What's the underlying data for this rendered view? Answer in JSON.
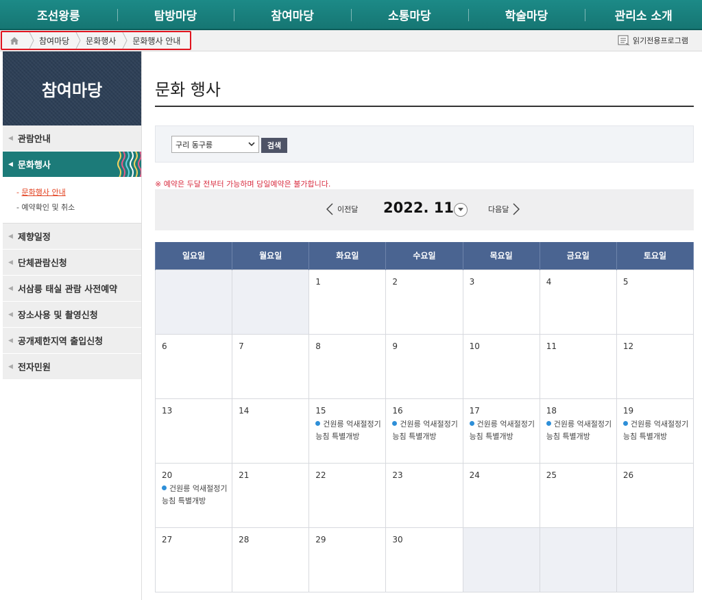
{
  "topnav": {
    "items": [
      "조선왕릉",
      "탐방마당",
      "참여마당",
      "소통마당",
      "학술마당",
      "관리소 소개"
    ]
  },
  "breadcrumb": {
    "items": [
      "참여마당",
      "문화행사",
      "문화행사 안내"
    ]
  },
  "reader_label": "읽기전용프로그램",
  "sidebar": {
    "title": "참여마당",
    "items": [
      "관람안내",
      "문화행사",
      "제향일정",
      "단체관람신청",
      "서삼릉 태실 관람 사전예약",
      "장소사용 및 촬영신청",
      "공개제한지역 출입신청",
      "전자민원"
    ],
    "sub_items": [
      "문화행사 안내",
      "예약확인 및 취소"
    ]
  },
  "main": {
    "title": "문화 행사",
    "select_value": "구리 동구릉",
    "search_label": "검색",
    "notice": "※ 예약은 두달 전부터 가능하며 당일예약은 불가합니다.",
    "prev_label": "이전달",
    "next_label": "다음달",
    "month": "2022. 11"
  },
  "calendar": {
    "weekdays": [
      "일요일",
      "월요일",
      "화요일",
      "수요일",
      "목요일",
      "금요일",
      "토요일"
    ],
    "event_title": "건원릉 억새절정기 능침 특별개방",
    "weeks": [
      [
        null,
        null,
        "1",
        "2",
        "3",
        "4",
        "5"
      ],
      [
        "6",
        "7",
        "8",
        "9",
        "10",
        "11",
        "12"
      ],
      [
        "13",
        "14",
        "15",
        "16",
        "17",
        "18",
        "19"
      ],
      [
        "20",
        "21",
        "22",
        "23",
        "24",
        "25",
        "26"
      ],
      [
        "27",
        "28",
        "29",
        "30",
        null,
        null,
        null
      ]
    ],
    "event_days": [
      "15",
      "16",
      "17",
      "18",
      "19",
      "20"
    ]
  },
  "colors": {
    "nav": "#1c8a87",
    "sidebar_active": "#1c7b79",
    "calendar_header": "#4a6491",
    "notice": "#d82d40",
    "breadcrumb_border": "#e0141e",
    "event_dot": "#2e8fd8"
  },
  "icons": [
    "home-icon",
    "reader-icon",
    "chevron-left-icon",
    "chevron-right-icon",
    "chevron-down-icon"
  ]
}
